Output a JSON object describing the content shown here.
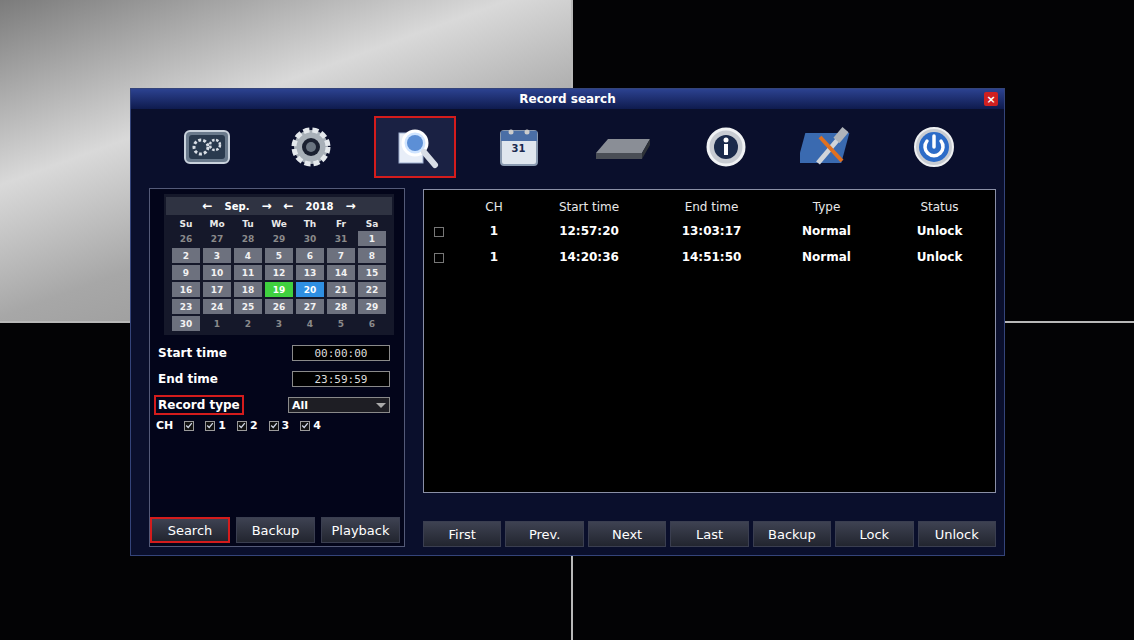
{
  "window": {
    "title": "Record search",
    "close": "×"
  },
  "toolbar": {
    "items": [
      {
        "selected": false,
        "highlighted": false
      },
      {
        "selected": false,
        "highlighted": false
      },
      {
        "selected": true,
        "highlighted": true
      },
      {
        "selected": false,
        "highlighted": false,
        "text": "31"
      },
      {
        "selected": false,
        "highlighted": false
      },
      {
        "selected": false,
        "highlighted": false
      },
      {
        "selected": false,
        "highlighted": false
      },
      {
        "selected": false,
        "highlighted": false
      }
    ]
  },
  "calendar": {
    "prev_month": "←",
    "month": "Sep.",
    "next_month": "→",
    "prev_year": "←",
    "year": "2018",
    "next_year": "→",
    "weekdays": [
      "Su",
      "Mo",
      "Tu",
      "We",
      "Th",
      "Fr",
      "Sa"
    ],
    "days": [
      {
        "day": "26",
        "in_month": false,
        "selected": false,
        "has_record": false
      },
      {
        "day": "27",
        "in_month": false,
        "selected": false,
        "has_record": false
      },
      {
        "day": "28",
        "in_month": false,
        "selected": false,
        "has_record": false
      },
      {
        "day": "29",
        "in_month": false,
        "selected": false,
        "has_record": false
      },
      {
        "day": "30",
        "in_month": false,
        "selected": false,
        "has_record": false
      },
      {
        "day": "31",
        "in_month": false,
        "selected": false,
        "has_record": false
      },
      {
        "day": "1",
        "in_month": true,
        "selected": false,
        "has_record": false
      },
      {
        "day": "2",
        "in_month": true,
        "selected": false,
        "has_record": false
      },
      {
        "day": "3",
        "in_month": true,
        "selected": false,
        "has_record": false
      },
      {
        "day": "4",
        "in_month": true,
        "selected": false,
        "has_record": false
      },
      {
        "day": "5",
        "in_month": true,
        "selected": false,
        "has_record": false
      },
      {
        "day": "6",
        "in_month": true,
        "selected": false,
        "has_record": false
      },
      {
        "day": "7",
        "in_month": true,
        "selected": false,
        "has_record": false
      },
      {
        "day": "8",
        "in_month": true,
        "selected": false,
        "has_record": false
      },
      {
        "day": "9",
        "in_month": true,
        "selected": false,
        "has_record": false
      },
      {
        "day": "10",
        "in_month": true,
        "selected": false,
        "has_record": false
      },
      {
        "day": "11",
        "in_month": true,
        "selected": false,
        "has_record": false
      },
      {
        "day": "12",
        "in_month": true,
        "selected": false,
        "has_record": false
      },
      {
        "day": "13",
        "in_month": true,
        "selected": false,
        "has_record": false
      },
      {
        "day": "14",
        "in_month": true,
        "selected": false,
        "has_record": false
      },
      {
        "day": "15",
        "in_month": true,
        "selected": false,
        "has_record": false
      },
      {
        "day": "16",
        "in_month": true,
        "selected": false,
        "has_record": false
      },
      {
        "day": "17",
        "in_month": true,
        "selected": false,
        "has_record": false
      },
      {
        "day": "18",
        "in_month": true,
        "selected": false,
        "has_record": false
      },
      {
        "day": "19",
        "in_month": true,
        "selected": false,
        "has_record": true
      },
      {
        "day": "20",
        "in_month": true,
        "selected": true,
        "has_record": false
      },
      {
        "day": "21",
        "in_month": true,
        "selected": false,
        "has_record": false
      },
      {
        "day": "22",
        "in_month": true,
        "selected": false,
        "has_record": false
      },
      {
        "day": "23",
        "in_month": true,
        "selected": false,
        "has_record": false
      },
      {
        "day": "24",
        "in_month": true,
        "selected": false,
        "has_record": false
      },
      {
        "day": "25",
        "in_month": true,
        "selected": false,
        "has_record": false
      },
      {
        "day": "26",
        "in_month": true,
        "selected": false,
        "has_record": false
      },
      {
        "day": "27",
        "in_month": true,
        "selected": false,
        "has_record": false
      },
      {
        "day": "28",
        "in_month": true,
        "selected": false,
        "has_record": false
      },
      {
        "day": "29",
        "in_month": true,
        "selected": false,
        "has_record": false
      },
      {
        "day": "30",
        "in_month": true,
        "selected": false,
        "has_record": false
      },
      {
        "day": "1",
        "in_month": false,
        "selected": false,
        "has_record": false
      },
      {
        "day": "2",
        "in_month": false,
        "selected": false,
        "has_record": false
      },
      {
        "day": "3",
        "in_month": false,
        "selected": false,
        "has_record": false
      },
      {
        "day": "4",
        "in_month": false,
        "selected": false,
        "has_record": false
      },
      {
        "day": "5",
        "in_month": false,
        "selected": false,
        "has_record": false
      },
      {
        "day": "6",
        "in_month": false,
        "selected": false,
        "has_record": false
      }
    ]
  },
  "filters": {
    "start_time": {
      "label": "Start time",
      "value": "00:00:00"
    },
    "end_time": {
      "label": "End time",
      "value": "23:59:59"
    },
    "record_type": {
      "label": "Record type",
      "value": "All",
      "highlighted": true
    },
    "channels": {
      "label": "CH",
      "all_checked": true,
      "items": [
        {
          "label": "1",
          "checked": true
        },
        {
          "label": "2",
          "checked": true
        },
        {
          "label": "3",
          "checked": true
        },
        {
          "label": "4",
          "checked": true
        }
      ]
    }
  },
  "left_buttons": [
    {
      "label": "Search",
      "highlighted": true
    },
    {
      "label": "Backup",
      "highlighted": false
    },
    {
      "label": "Playback",
      "highlighted": false
    }
  ],
  "table": {
    "columns": [
      "CH",
      "Start time",
      "End time",
      "Type",
      "Status"
    ],
    "rows": [
      {
        "checked": false,
        "cells": [
          "1",
          "12:57:20",
          "13:03:17",
          "Normal",
          "Unlock"
        ]
      },
      {
        "checked": false,
        "cells": [
          "1",
          "14:20:36",
          "14:51:50",
          "Normal",
          "Unlock"
        ]
      }
    ]
  },
  "table_buttons": [
    "First",
    "Prev.",
    "Next",
    "Last",
    "Backup",
    "Lock",
    "Unlock"
  ]
}
